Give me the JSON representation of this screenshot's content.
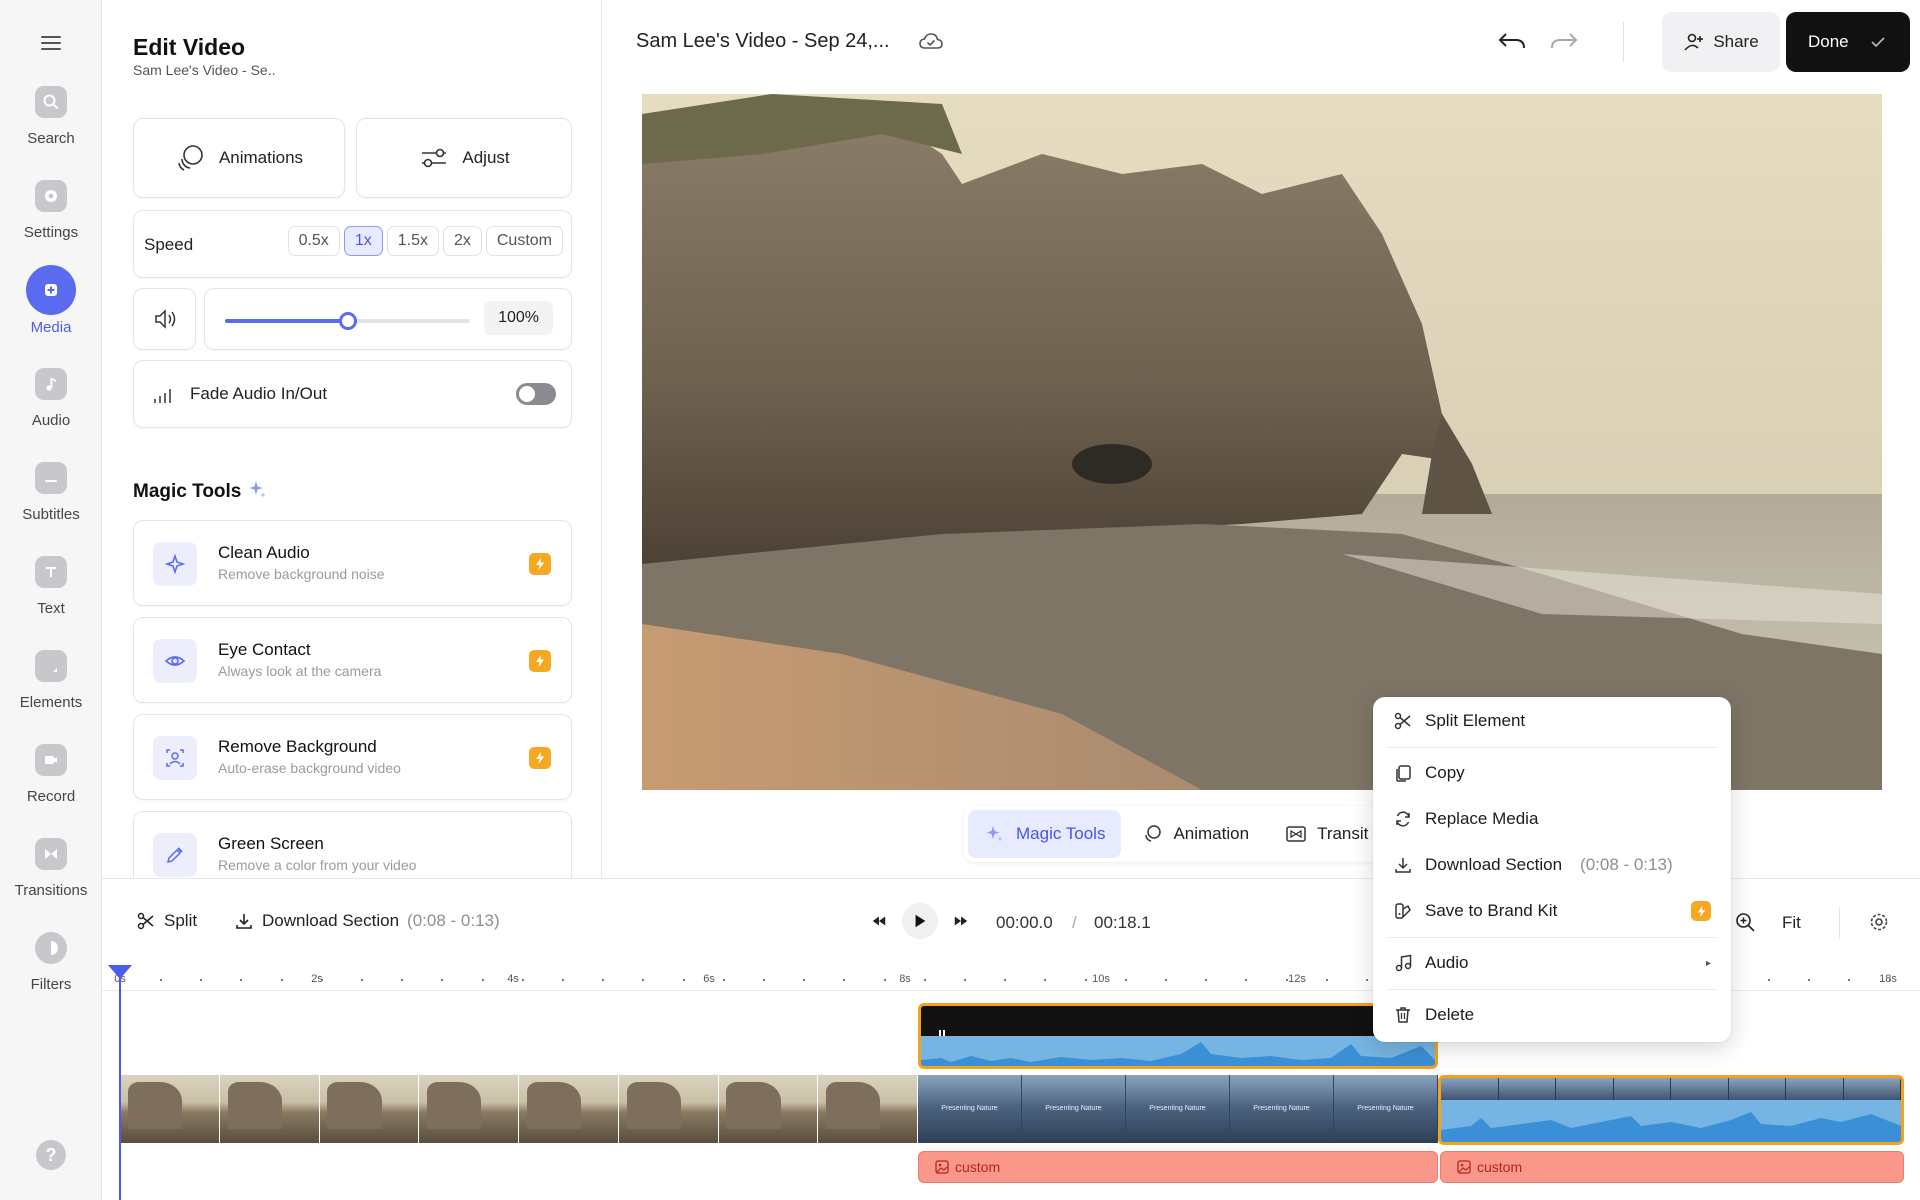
{
  "rail": {
    "items": [
      {
        "label": "Search",
        "icon": "search-icon"
      },
      {
        "label": "Settings",
        "icon": "gear-icon"
      },
      {
        "label": "Media",
        "icon": "plus-icon",
        "active": true
      },
      {
        "label": "Audio",
        "icon": "music-note-icon"
      },
      {
        "label": "Subtitles",
        "icon": "subtitles-icon"
      },
      {
        "label": "Text",
        "icon": "text-icon"
      },
      {
        "label": "Elements",
        "icon": "elements-icon"
      },
      {
        "label": "Record",
        "icon": "video-camera-icon"
      },
      {
        "label": "Transitions",
        "icon": "transition-icon"
      },
      {
        "label": "Filters",
        "icon": "half-circle-icon"
      }
    ],
    "help": "?"
  },
  "panel": {
    "title": "Edit Video",
    "subtitle": "Sam Lee's Video - Se..",
    "animations_label": "Animations",
    "adjust_label": "Adjust",
    "speed_label": "Speed",
    "speed_options": [
      "0.5x",
      "1x",
      "1.5x",
      "2x",
      "Custom"
    ],
    "speed_selected": "1x",
    "volume_level": 0.5,
    "volume_value": "100%",
    "fade_label": "Fade Audio In/Out",
    "fade_enabled": false,
    "magic_title": "Magic Tools",
    "magic_tools": [
      {
        "name": "Clean Audio",
        "desc": "Remove background noise",
        "icon": "sparkle-icon"
      },
      {
        "name": "Eye Contact",
        "desc": "Always look at the camera",
        "icon": "eye-icon"
      },
      {
        "name": "Remove Background",
        "desc": "Auto-erase background video",
        "icon": "person-scan-icon"
      },
      {
        "name": "Green Screen",
        "desc": "Remove a color from your video",
        "icon": "eyedropper-icon"
      }
    ]
  },
  "topbar": {
    "project_title": "Sam Lee's Video - Sep 24,...",
    "share_label": "Share",
    "done_label": "Done"
  },
  "video_tools": {
    "magic_label": "Magic Tools",
    "animation_label": "Animation",
    "transition_label": "Transit"
  },
  "timeline": {
    "split_label": "Split",
    "download_label": "Download Section",
    "download_range": "(0:08 - 0:13)",
    "time_current": "00:00.0",
    "time_separator": "/",
    "time_total": "00:18.1",
    "fit_label": "Fit",
    "ruler_labels": [
      "0s",
      "2s",
      "4s",
      "6s",
      "8s",
      "10s",
      "12s",
      "18s"
    ],
    "clip_text": "Presenting Nature",
    "custom_label_1": "custom",
    "custom_label_2": "custom"
  },
  "context_menu": {
    "split": "Split Element",
    "copy": "Copy",
    "replace": "Replace Media",
    "download": "Download Section",
    "download_range": "(0:08 - 0:13)",
    "brand": "Save to Brand Kit",
    "audio": "Audio",
    "delete": "Delete"
  },
  "colors": {
    "accent": "#5b6bf0",
    "bolt": "#f7a823",
    "clip_border": "#f2a31b",
    "custom_clip": "#f8978a"
  }
}
